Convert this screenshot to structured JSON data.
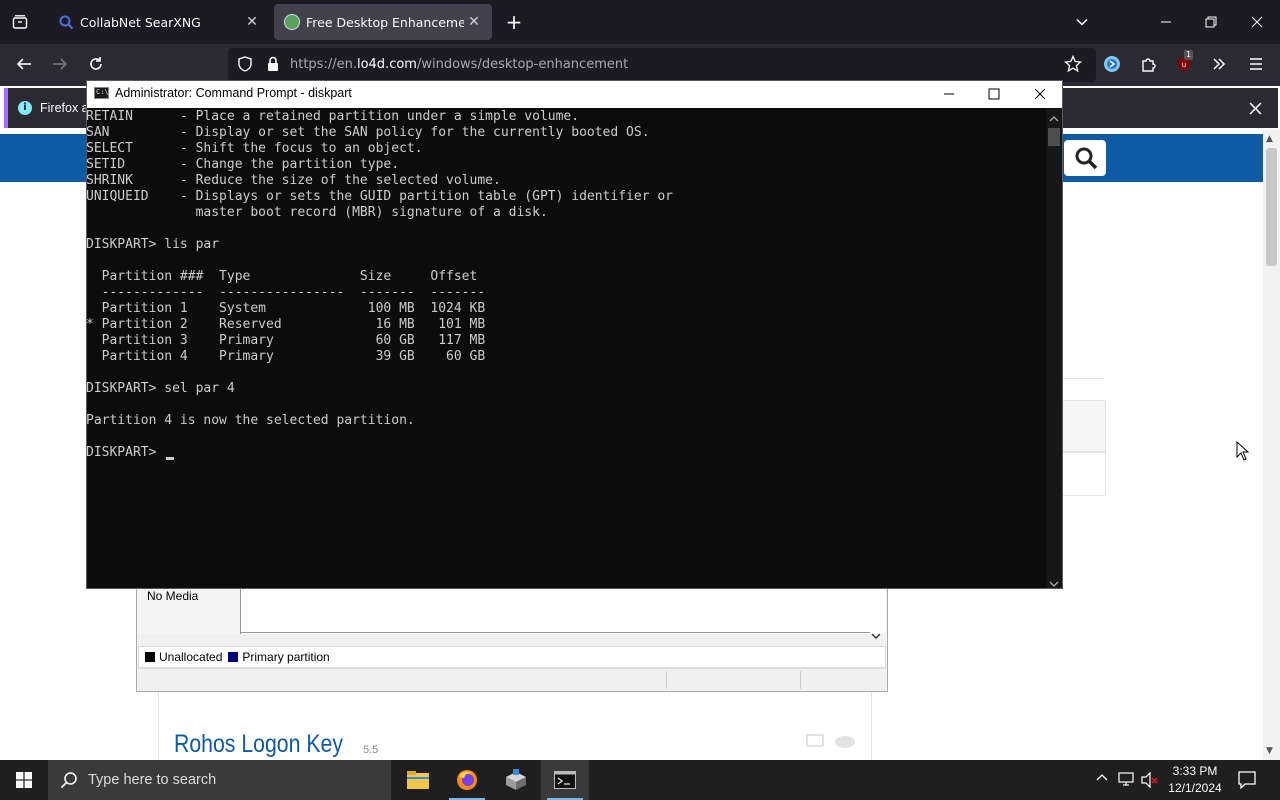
{
  "browser": {
    "tabs": [
      {
        "title": "CollabNet SearXNG",
        "active": false
      },
      {
        "title": "Free Desktop Enhancement Sof",
        "active": true
      }
    ],
    "url_prefix": "https://en.",
    "url_domain": "lo4d.com",
    "url_path": "/windows/desktop-enhancement",
    "notification_text": "Firefox a",
    "extension_badge": "1",
    "accent_color": "#a66efd"
  },
  "cmd": {
    "title": "Administrator: Command Prompt - diskpart",
    "output": "RETAIN      - Place a retained partition under a simple volume.\nSAN         - Display or set the SAN policy for the currently booted OS.\nSELECT      - Shift the focus to an object.\nSETID       - Change the partition type.\nSHRINK      - Reduce the size of the selected volume.\nUNIQUEID    - Displays or sets the GUID partition table (GPT) identifier or\n              master boot record (MBR) signature of a disk.\n\nDISKPART> lis par\n\n  Partition ###  Type              Size     Offset\n  -------------  ----------------  -------  -------\n  Partition 1    System             100 MB  1024 KB\n* Partition 2    Reserved            16 MB   101 MB\n  Partition 3    Primary             60 GB   117 MB\n  Partition 4    Primary             39 GB    60 GB\n\nDISKPART> sel par 4\n\nPartition 4 is now the selected partition.\n\nDISKPART> "
  },
  "disk_management": {
    "disk_label": "No Media",
    "legend": [
      {
        "label": "Unallocated",
        "color": "#000000"
      },
      {
        "label": "Primary partition",
        "color": "#00007f"
      }
    ]
  },
  "page": {
    "article_title": "Rohos Logon Key",
    "article_version": "5.5",
    "brand_color": "#0f5aa4"
  },
  "taskbar": {
    "search_placeholder": "Type here to search",
    "time": "3:33 PM",
    "date": "12/1/2024"
  }
}
